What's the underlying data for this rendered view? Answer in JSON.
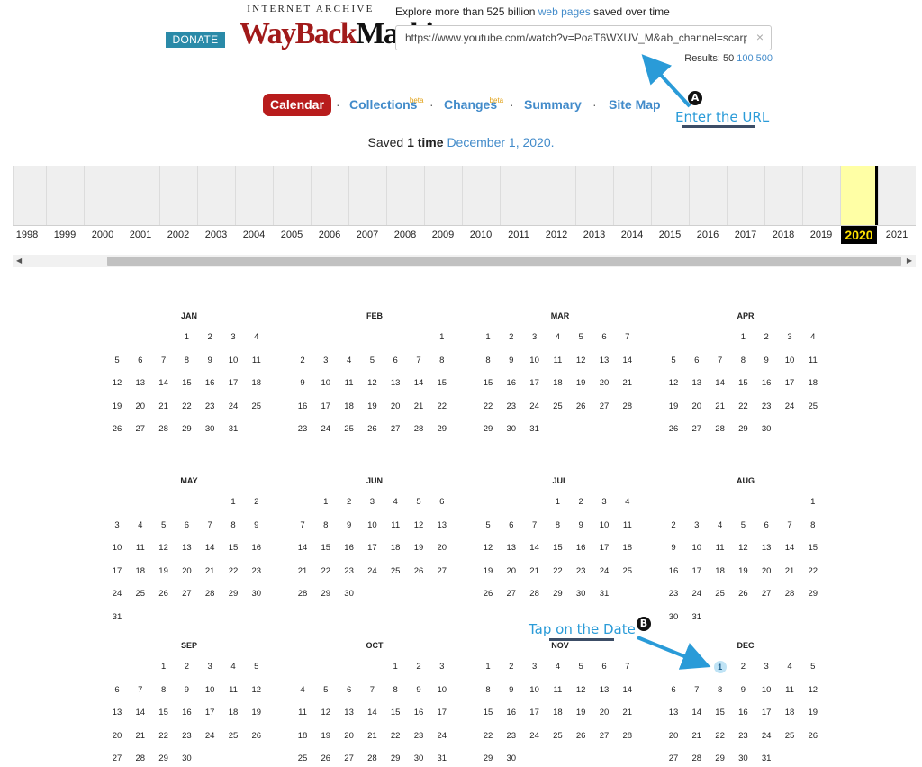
{
  "header": {
    "donate_label": "DONATE",
    "logo_top": "INTERNET ARCHIVE",
    "logo_main_part1": "WayBack",
    "logo_main_part2": "Machine",
    "explore_prefix": "Explore more than 525 billion ",
    "explore_link": "web pages",
    "explore_suffix": " saved over time",
    "url_value": "https://www.youtube.com/watch?v=PoaT6WXUV_M&ab_channel=scarp",
    "clear_symbol": "×",
    "results_label": "Results: 50",
    "results_100": "100",
    "results_500": "500"
  },
  "nav": {
    "items": [
      {
        "label": "Calendar",
        "active": true
      },
      {
        "label": "Collections",
        "beta": "beta"
      },
      {
        "label": "Changes",
        "beta": "beta"
      },
      {
        "label": "Summary"
      },
      {
        "label": "Site Map"
      }
    ],
    "separator": "·"
  },
  "saved": {
    "prefix": "Saved ",
    "count": "1 time",
    "date": "December 1, 2020."
  },
  "timeline": {
    "years": [
      "1998",
      "1999",
      "2000",
      "2001",
      "2002",
      "2003",
      "2004",
      "2005",
      "2006",
      "2007",
      "2008",
      "2009",
      "2010",
      "2011",
      "2012",
      "2013",
      "2014",
      "2015",
      "2016",
      "2017",
      "2018",
      "2019",
      "2020",
      "2021"
    ],
    "active_year": "2020"
  },
  "calendar": {
    "year": 2020,
    "months": [
      "JAN",
      "FEB",
      "MAR",
      "APR",
      "MAY",
      "JUN",
      "JUL",
      "AUG",
      "SEP",
      "OCT",
      "NOV",
      "DEC"
    ],
    "captured": [
      {
        "month": 12,
        "day": 1
      }
    ]
  },
  "annotations": {
    "a_badge": "A",
    "a_label": "Enter the URL",
    "b_badge": "B",
    "b_label": "Tap on the Date",
    "color": "#2a9bd8"
  }
}
